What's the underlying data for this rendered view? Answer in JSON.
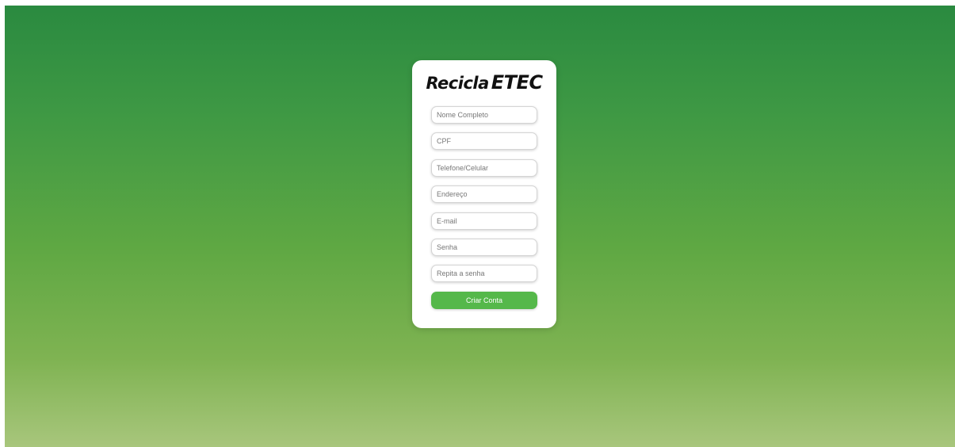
{
  "brand": {
    "part1": "Recicla",
    "part2": "ETEC"
  },
  "form": {
    "fields": [
      {
        "placeholder": "Nome Completo"
      },
      {
        "placeholder": "CPF"
      },
      {
        "placeholder": "Telefone/Celular"
      },
      {
        "placeholder": "Endereço"
      },
      {
        "placeholder": "E-mail"
      },
      {
        "placeholder": "Senha"
      },
      {
        "placeholder": "Repita a senha"
      }
    ],
    "submit_label": "Criar Conta"
  },
  "colors": {
    "accent": "#55b84a",
    "background_top": "#2a8a40",
    "background_bottom": "#a8c67c"
  }
}
